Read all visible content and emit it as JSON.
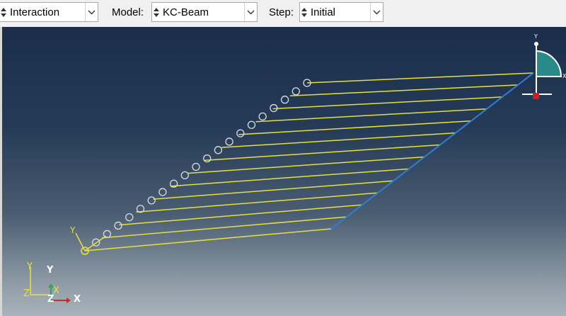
{
  "toolbar": {
    "module_value": "Interaction",
    "model_label": "Model:",
    "model_value": "KC-Beam",
    "step_label": "Step:",
    "step_value": "Initial"
  },
  "viewport": {
    "background_top": "#1a2e4b",
    "background_bottom": "#a9b3bb",
    "beam_color": "#e6e03c",
    "edge_color": "#2f7fd0",
    "beam_count": 14
  },
  "triad": {
    "y_label": "Y",
    "x_label": "X",
    "z_label": "Z"
  },
  "boundary_symbol": {
    "y_label": "Y",
    "x_label": "X"
  },
  "icons": {
    "spin": "spin-arrows-icon",
    "dropdown": "chevron-down-icon"
  }
}
